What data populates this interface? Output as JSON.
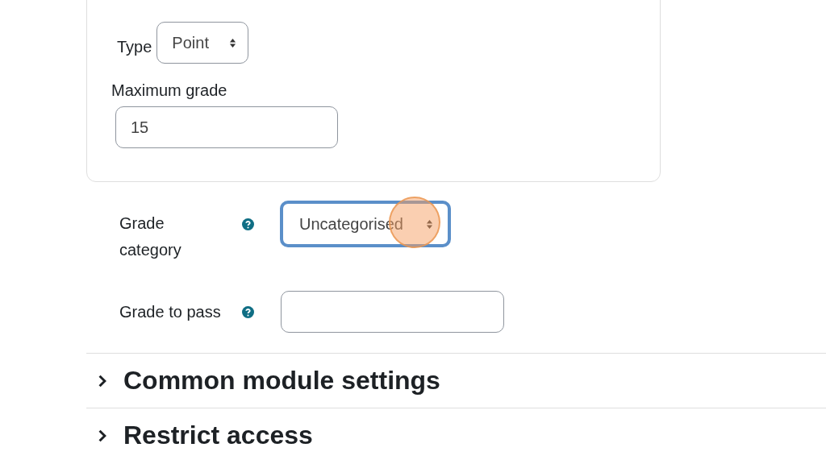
{
  "grade_card": {
    "type": {
      "label": "Type",
      "value": "Point"
    },
    "maximum_grade": {
      "label": "Maximum grade",
      "value": "15"
    }
  },
  "fields": [
    {
      "kind": "select",
      "label": "Grade category",
      "value": "Uncategorised",
      "focused": true,
      "clicked": true
    },
    {
      "kind": "text",
      "label": "Grade to pass",
      "focused": false,
      "clicked": false
    }
  ],
  "sections": [
    {
      "title": "Common module settings",
      "expanded": false
    },
    {
      "title": "Restrict access",
      "expanded": false
    }
  ]
}
